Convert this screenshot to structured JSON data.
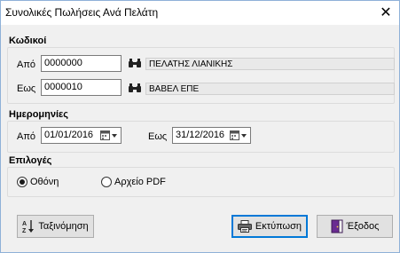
{
  "window": {
    "title": "Συνολικές Πωλήσεις Ανά Πελάτη"
  },
  "codes": {
    "title": "Κωδικοί",
    "from_label": "Από",
    "from_value": "0000000",
    "from_name": "ΠΕΛΑΤΗΣ ΛΙΑΝΙΚΗΣ",
    "to_label": "Εως",
    "to_value": "0000010",
    "to_name": "ΒΑΒΕΛ ΕΠΕ"
  },
  "dates": {
    "title": "Ημερομηνίες",
    "from_label": "Από",
    "from_value": "01/01/2016",
    "to_label": "Εως",
    "to_value": "31/12/2016"
  },
  "options": {
    "title": "Επιλογές",
    "screen_label": "Οθόνη",
    "pdf_label": "Αρχείο PDF",
    "selected": "Οθόνη"
  },
  "buttons": {
    "sort_label": "Ταξινόμηση",
    "print_label": "Εκτύπωση",
    "exit_label": "Έξοδος"
  },
  "icons": {
    "binoculars": "binoculars-icon",
    "calendar": "calendar-icon",
    "sort": "sort-az-icon",
    "printer": "printer-icon",
    "exit": "exit-door-icon"
  }
}
